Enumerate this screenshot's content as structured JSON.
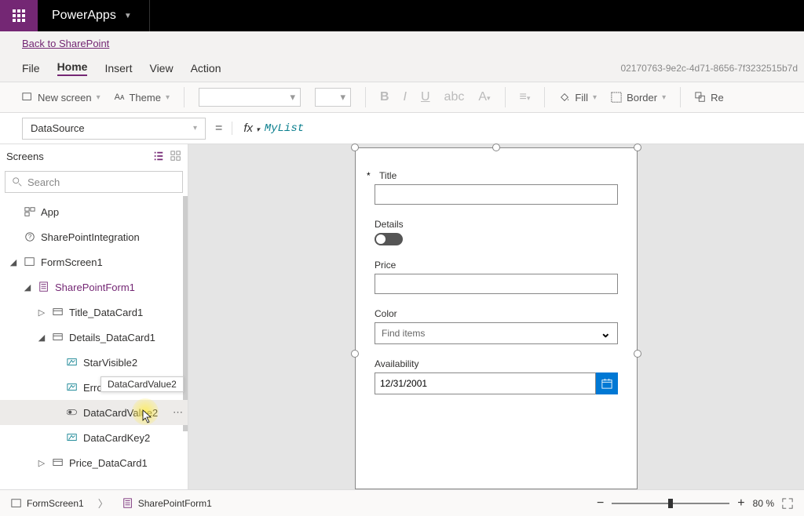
{
  "titlebar": {
    "app_name": "PowerApps"
  },
  "back_link": "Back to SharePoint",
  "menu": {
    "file": "File",
    "home": "Home",
    "insert": "Insert",
    "view": "View",
    "action": "Action"
  },
  "file_id": "02170763-9e2c-4d71-8656-7f3232515b7d",
  "toolbar": {
    "new_screen": "New screen",
    "theme": "Theme",
    "fill": "Fill",
    "border": "Border",
    "reorder": "Re"
  },
  "formula": {
    "property": "DataSource",
    "value": "MyList"
  },
  "left_panel": {
    "title": "Screens",
    "search_placeholder": "Search",
    "tree": {
      "app": "App",
      "spi": "SharePointIntegration",
      "formscreen": "FormScreen1",
      "spform": "SharePointForm1",
      "title_dc": "Title_DataCard1",
      "details_dc": "Details_DataCard1",
      "star": "StarVisible2",
      "error": "ErrorM",
      "dcv": "DataCardValue2",
      "dck": "DataCardKey2",
      "price_dc": "Price_DataCard1"
    },
    "tooltip": "DataCardValue2"
  },
  "form": {
    "title_label": "Title",
    "details_label": "Details",
    "price_label": "Price",
    "color_label": "Color",
    "color_placeholder": "Find items",
    "avail_label": "Availability",
    "avail_value": "12/31/2001"
  },
  "status": {
    "crumb1": "FormScreen1",
    "crumb2": "SharePointForm1",
    "zoom_pct": "80 %"
  }
}
